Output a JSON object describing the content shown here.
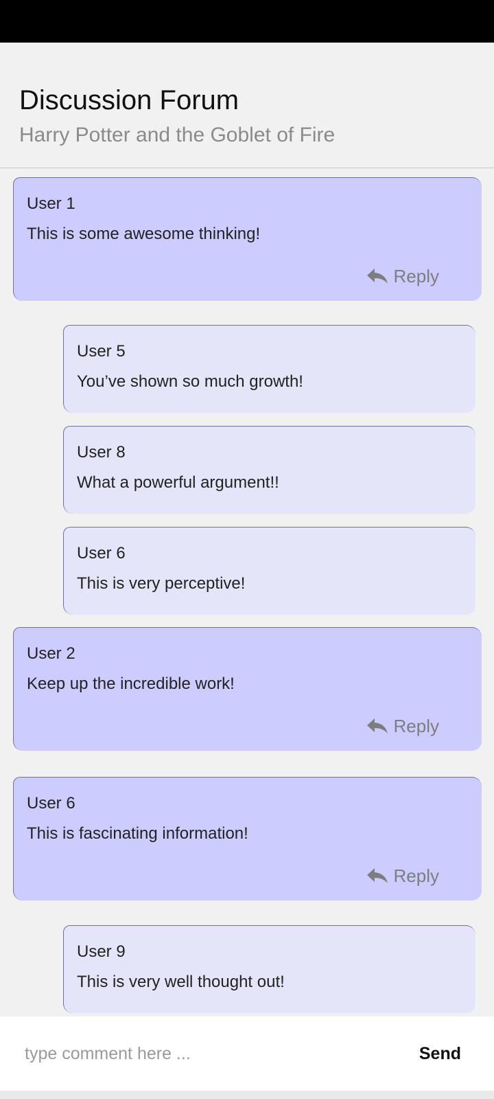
{
  "header": {
    "title": "Discussion Forum",
    "subtitle": "Harry Potter and the Goblet of Fire"
  },
  "reply_label": "Reply",
  "reply_icon": "reply-arrow-icon",
  "colors": {
    "top_level_card": "#ccccff",
    "nested_card": "#e5e5f9",
    "background": "#f1f1f1"
  },
  "comments": [
    {
      "user": "User 1",
      "text": "This is some awesome thinking!",
      "level": "top"
    },
    {
      "user": "User 5",
      "text": "You’ve shown so much growth!",
      "level": "reply"
    },
    {
      "user": "User 8",
      "text": "What a powerful argument!!",
      "level": "reply"
    },
    {
      "user": "User 6",
      "text": "This is very perceptive!",
      "level": "reply"
    },
    {
      "user": "User 2",
      "text": "Keep up the incredible work!",
      "level": "top"
    },
    {
      "user": "User 6",
      "text": "This is fascinating information!",
      "level": "top"
    },
    {
      "user": "User 9",
      "text": "This is very well thought out!",
      "level": "reply"
    }
  ],
  "composer": {
    "placeholder": "type comment here ...",
    "value": "",
    "send_label": "Send"
  }
}
